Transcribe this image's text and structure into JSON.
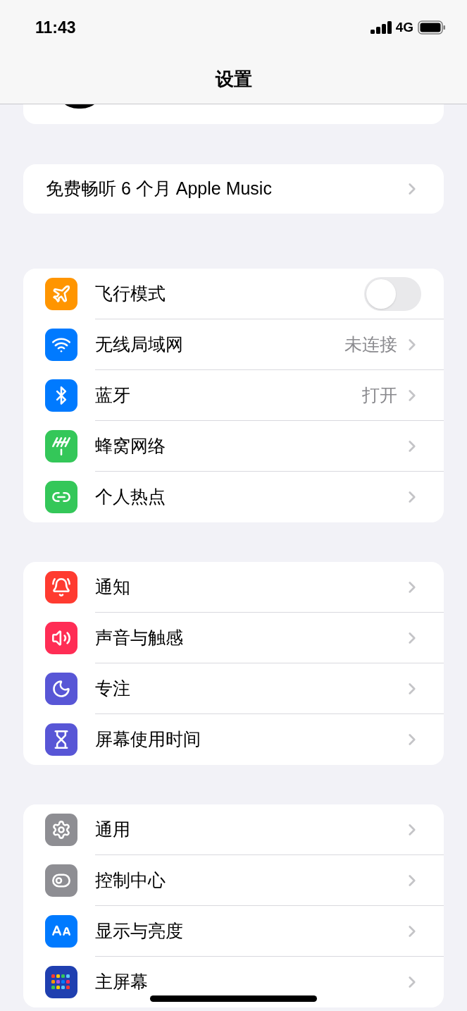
{
  "status_bar": {
    "time": "11:43",
    "network": "4G"
  },
  "header": {
    "title": "设置"
  },
  "promo": {
    "label": "免费畅听 6 个月 Apple Music"
  },
  "groups": [
    {
      "rows": [
        {
          "kind": "toggle",
          "label": "飞行模式",
          "color": "#ff9500",
          "on": false
        },
        {
          "kind": "link",
          "label": "无线局域网",
          "color": "#007aff",
          "value": "未连接"
        },
        {
          "kind": "link",
          "label": "蓝牙",
          "color": "#007aff",
          "value": "打开"
        },
        {
          "kind": "link",
          "label": "蜂窝网络",
          "color": "#34c759"
        },
        {
          "kind": "link",
          "label": "个人热点",
          "color": "#34c759"
        }
      ]
    },
    {
      "rows": [
        {
          "kind": "link",
          "label": "通知",
          "color": "#ff3b30"
        },
        {
          "kind": "link",
          "label": "声音与触感",
          "color": "#ff2d55"
        },
        {
          "kind": "link",
          "label": "专注",
          "color": "#5856d6"
        },
        {
          "kind": "link",
          "label": "屏幕使用时间",
          "color": "#5856d6"
        }
      ]
    },
    {
      "rows": [
        {
          "kind": "link",
          "label": "通用",
          "color": "#8e8e93"
        },
        {
          "kind": "link",
          "label": "控制中心",
          "color": "#8e8e93"
        },
        {
          "kind": "link",
          "label": "显示与亮度",
          "color": "#007aff"
        },
        {
          "kind": "link",
          "label": "主屏幕",
          "color": "#1f3fb0"
        }
      ]
    }
  ]
}
